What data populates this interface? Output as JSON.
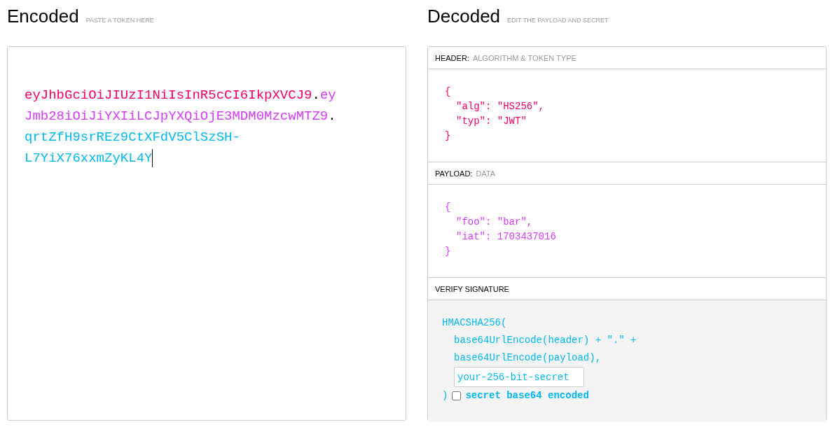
{
  "encoded": {
    "title": "Encoded",
    "subtitle": "PASTE A TOKEN HERE",
    "token_lines": [
      [
        {
          "kind": "header",
          "text": "eyJhbGciOiJIUzI1NiIsInR5cCI6IkpXVCJ9"
        },
        {
          "kind": "dot",
          "text": "."
        },
        {
          "kind": "payload",
          "text": "ey"
        }
      ],
      [
        {
          "kind": "payload",
          "text": "Jmb28iOiJiYXIiLCJpYXQiOjE3MDM0MzcwMTZ9"
        },
        {
          "kind": "dot",
          "text": "."
        }
      ],
      [
        {
          "kind": "signature",
          "text": "qrtZfH9srREz9CtXFdV5ClSzSH-"
        }
      ],
      [
        {
          "kind": "signature",
          "text": "L7YiX76xxmZyKL4Y"
        }
      ]
    ]
  },
  "decoded": {
    "title": "Decoded",
    "subtitle": "EDIT THE PAYLOAD AND SECRET",
    "header": {
      "label": "HEADER:",
      "hint": "ALGORITHM & TOKEN TYPE",
      "lines": [
        {
          "kind": "brace",
          "text": "{"
        },
        {
          "kind": "entry",
          "text": "\"alg\": \"HS256\","
        },
        {
          "kind": "entry",
          "text": "\"typ\": \"JWT\""
        },
        {
          "kind": "brace",
          "text": "}"
        }
      ]
    },
    "payload": {
      "label": "PAYLOAD:",
      "hint": "DATA",
      "lines": [
        {
          "kind": "brace",
          "text": "{"
        },
        {
          "kind": "entry",
          "text": "\"foo\": \"bar\","
        },
        {
          "kind": "entry",
          "text": "\"iat\": 1703437016"
        },
        {
          "kind": "brace",
          "text": "}"
        }
      ]
    },
    "signature": {
      "label": "VERIFY SIGNATURE",
      "open": "HMACSHA256(",
      "args": [
        "base64UrlEncode(header) + \".\" +",
        "base64UrlEncode(payload),"
      ],
      "secret": "your-256-bit-secret",
      "close": ")",
      "base64": {
        "label": "secret base64 encoded",
        "checked": false
      }
    }
  }
}
